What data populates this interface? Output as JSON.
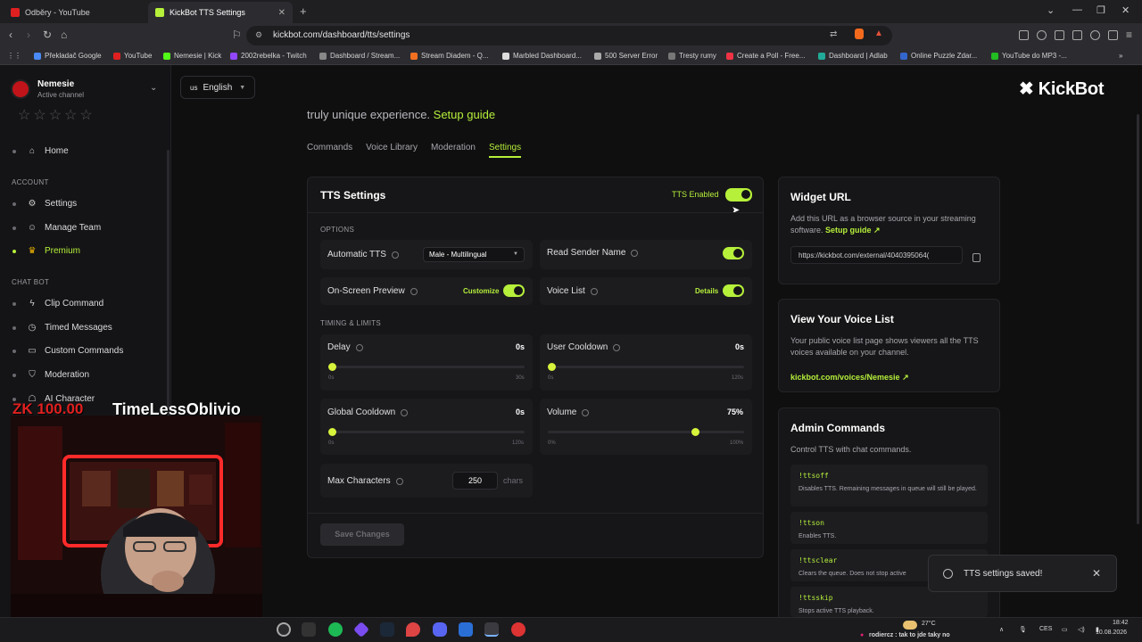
{
  "browser": {
    "tabs": [
      {
        "title": "Odběry - YouTube"
      },
      {
        "title": "KickBot TTS Settings"
      }
    ],
    "url": "kickbot.com/dashboard/tts/settings",
    "bookmarks": [
      "Překladač Google",
      "YouTube",
      "Nemesie | Kick",
      "2002rebelka - Twitch",
      "Dashboard / Stream...",
      "Stream Diadem - Q...",
      "Marbled Dashboard...",
      "500 Server Error",
      "Tresty rumy",
      "Create a Poll - Free...",
      "Dashboard | Adlab",
      "Online Puzzle Zdar...",
      "YouTube do MP3 -..."
    ]
  },
  "sidebar": {
    "channel": {
      "name": "Nemesie",
      "status": "Active channel"
    },
    "stars": "☆☆☆☆☆",
    "home": "Home",
    "account_header": "ACCOUNT",
    "account_items": [
      "Settings",
      "Manage Team",
      "Premium"
    ],
    "chatbot_header": "CHAT BOT",
    "chatbot_items": [
      "Clip Command",
      "Timed Messages",
      "Custom Commands",
      "Moderation",
      "AI Character"
    ]
  },
  "topbar": {
    "lang_flag": "us",
    "lang": "English",
    "logo": "✖ KickBot"
  },
  "intro": {
    "text": "truly unique experience. ",
    "link": "Setup guide"
  },
  "tabs": [
    "Commands",
    "Voice Library",
    "Moderation",
    "Settings"
  ],
  "tts": {
    "title": "TTS Settings",
    "enabled_label": "TTS Enabled",
    "options_header": "OPTIONS",
    "automatic_tts": {
      "label": "Automatic TTS",
      "value": "Male - Multilingual"
    },
    "read_sender": {
      "label": "Read Sender Name"
    },
    "onscreen": {
      "label": "On-Screen Preview",
      "action": "Customize"
    },
    "voice_list": {
      "label": "Voice List",
      "action": "Details"
    },
    "timing_header": "TIMING & LIMITS",
    "delay": {
      "label": "Delay",
      "value": "0s",
      "min": "0s",
      "max": "30s",
      "level": 0
    },
    "user_cooldown": {
      "label": "User Cooldown",
      "value": "0s",
      "min": "0s",
      "max": "120s",
      "level": 0
    },
    "global_cooldown": {
      "label": "Global Cooldown",
      "value": "0s",
      "min": "0s",
      "max": "120s",
      "level": 0
    },
    "volume": {
      "label": "Volume",
      "value": "75%",
      "min": "0%",
      "max": "100%",
      "level": 0.75
    },
    "max_chars": {
      "label": "Max Characters",
      "value": "250",
      "unit": "chars"
    },
    "save": "Save Changes"
  },
  "widget": {
    "title": "Widget URL",
    "desc": "Add this URL as a browser source in your streaming software. ",
    "link": "Setup guide",
    "url": "https://kickbot.com/external/4040395064("
  },
  "voicelist": {
    "title": "View Your Voice List",
    "desc": "Your public voice list page shows viewers all the TTS voices available on your channel.",
    "link": "kickbot.com/voices/Nemesie"
  },
  "admin": {
    "title": "Admin Commands",
    "desc": "Control TTS with chat commands.",
    "commands": [
      {
        "name": "!ttsoff",
        "desc": "Disables TTS. Remaining messages in queue will still be played."
      },
      {
        "name": "!ttson",
        "desc": "Enables TTS."
      },
      {
        "name": "!ttsclear",
        "desc": "Clears the queue. Does not stop active"
      },
      {
        "name": "!ttsskip",
        "desc": "Stops active TTS playback."
      }
    ]
  },
  "toast": {
    "message": "TTS settings saved!"
  },
  "overlay": {
    "zk": "ZK 100.00",
    "name": "TimeLessOblivio"
  },
  "taskbar": {
    "weather": "27°C",
    "chat": "rodiercz : tak to jde taky no",
    "lang": "CES",
    "time": "18:42",
    "date": "10.08.2026"
  },
  "colors": {
    "accent": "#b6f03a",
    "background": "#0f0f10",
    "card": "#161618"
  }
}
